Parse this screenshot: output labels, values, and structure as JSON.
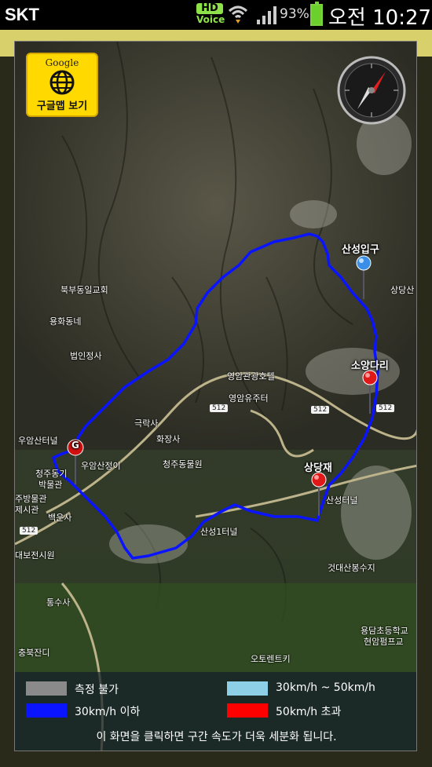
{
  "status_bar": {
    "carrier": "SKT",
    "hd_top": "HD",
    "hd_bottom": "Voice",
    "battery_percent": "93%",
    "battery_level": 0.93,
    "time": "오전 10:27"
  },
  "map": {
    "google_button": {
      "brand": "Google",
      "label": "구글맵 보기"
    },
    "compass_icon": "compass-icon",
    "route_color": "#0a14ff",
    "pins": [
      {
        "name": "start-pin",
        "label": "산성입구",
        "color": "#3a8ee8"
      },
      {
        "name": "checkpoint-pin-1",
        "label": "소양다리",
        "color": "#e01818"
      },
      {
        "name": "checkpoint-pin-2",
        "label": "상당재",
        "color": "#e01818"
      },
      {
        "name": "goal-pin",
        "label": "G",
        "color": "#d01010"
      }
    ],
    "places": [
      {
        "name": "place-bukbu",
        "text": "북부동일교회"
      },
      {
        "name": "place-yonghwa",
        "text": "용화동네"
      },
      {
        "name": "place-beobin",
        "text": "법인정사"
      },
      {
        "name": "place-yeongam-hotel",
        "text": "영암관광호텔"
      },
      {
        "name": "place-yeongam-center",
        "text": "영암유주터"
      },
      {
        "name": "place-geungnak",
        "text": "극락사"
      },
      {
        "name": "place-hwajang",
        "text": "화장사"
      },
      {
        "name": "place-cheongju-zoo",
        "text": "청주동물원"
      },
      {
        "name": "place-uam-tunnel",
        "text": "우암산터널"
      },
      {
        "name": "place-uam-top",
        "text": "우암산정이"
      },
      {
        "name": "place-museum",
        "text": "청주동기"
      },
      {
        "name": "place-museum-2",
        "text": "박물관"
      },
      {
        "name": "place-baekun",
        "text": "백운사"
      },
      {
        "name": "place-sanseong-tunnel",
        "text": "산성1터널"
      },
      {
        "name": "place-sanseong-tunnel-2",
        "text": "산성터널"
      },
      {
        "name": "place-sangdangsan",
        "text": "상당산"
      },
      {
        "name": "place-yeotdae",
        "text": "것대산봉수지"
      },
      {
        "name": "place-yongdam-school",
        "text": "용담초등학교"
      },
      {
        "name": "place-hyeonam",
        "text": "현암펌프교"
      },
      {
        "name": "place-auto-center",
        "text": "오토렌트키"
      },
      {
        "name": "place-tongsu",
        "text": "통수사"
      },
      {
        "name": "place-dae",
        "text": "대보전시원"
      },
      {
        "name": "place-chungbuk",
        "text": "충북잔디"
      },
      {
        "name": "place-jugu",
        "text": "주방물관"
      },
      {
        "name": "place-jugu-2",
        "text": "제시관"
      }
    ],
    "road_shields": [
      "512",
      "512",
      "512",
      "512"
    ]
  },
  "legend": {
    "items": [
      {
        "label": "측정 불가",
        "color": "#8a8a8a"
      },
      {
        "label": "30km/h ~ 50km/h",
        "color": "#8ecfe8"
      },
      {
        "label": "30km/h 이하",
        "color": "#0a14ff"
      },
      {
        "label": "50km/h 초과",
        "color": "#ff0000"
      }
    ],
    "note": "이 화면을 클릭하면 구간 속도가 더욱 세분화 됩니다."
  }
}
